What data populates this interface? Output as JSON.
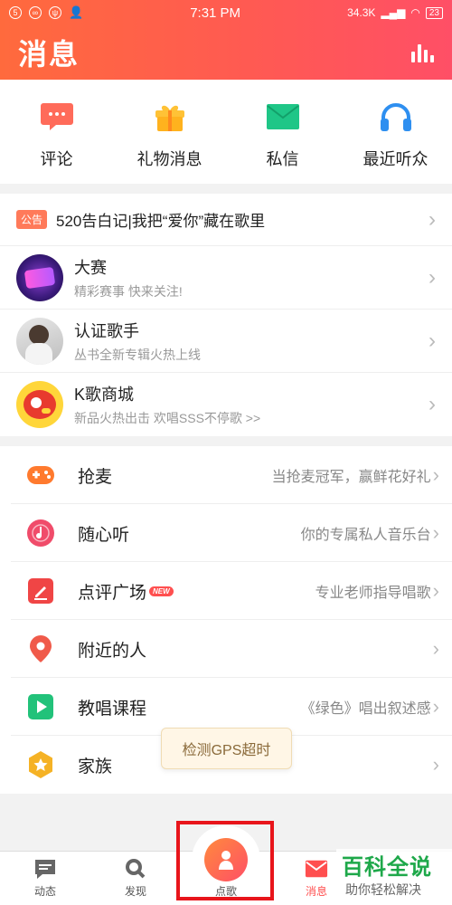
{
  "status": {
    "time": "7:31 PM",
    "speed": "34.3K",
    "battery": "23",
    "left_icons": [
      "5",
      "∞",
      "ψ",
      "👤"
    ]
  },
  "header": {
    "title": "消息"
  },
  "quick": [
    {
      "label": "评论",
      "icon": "comment-icon"
    },
    {
      "label": "礼物消息",
      "icon": "gift-icon"
    },
    {
      "label": "私信",
      "icon": "mail-icon"
    },
    {
      "label": "最近听众",
      "icon": "headphones-icon"
    }
  ],
  "notice": {
    "badge": "公告",
    "text": "520告白记|我把“爱你”藏在歌里"
  },
  "messages": [
    {
      "title": "大赛",
      "sub": "精彩赛事 快来关注!"
    },
    {
      "title": "认证歌手",
      "sub": "丛书全新专辑火热上线"
    },
    {
      "title": "K歌商城",
      "sub": "新品火热出击 欢唱SSS不停歌 >>"
    }
  ],
  "features": [
    {
      "label": "抢麦",
      "desc": "当抢麦冠军，赢鲜花好礼",
      "color": "#ff7a2e",
      "icon": "gamepad-icon"
    },
    {
      "label": "随心听",
      "desc": "你的专属私人音乐台",
      "color": "#f04c6a",
      "icon": "music-disc-icon"
    },
    {
      "label": "点评广场",
      "desc": "专业老师指导唱歌",
      "color": "#f04545",
      "icon": "pen-icon",
      "tag": "NEW"
    },
    {
      "label": "附近的人",
      "desc": "",
      "color": "#f05a4a",
      "icon": "location-icon"
    },
    {
      "label": "教唱课程",
      "desc": "《绿色》唱出叙述感",
      "color": "#22c27a",
      "icon": "play-icon"
    },
    {
      "label": "家族",
      "desc": "",
      "color": "#f5b225",
      "icon": "star-badge-icon"
    }
  ],
  "toast": "检测GPS超时",
  "nav": [
    {
      "label": "动态"
    },
    {
      "label": "发现"
    },
    {
      "label": "点歌"
    },
    {
      "label": "消息"
    }
  ],
  "watermark": {
    "line1": "百科全说",
    "line2": "助你轻松解决"
  }
}
